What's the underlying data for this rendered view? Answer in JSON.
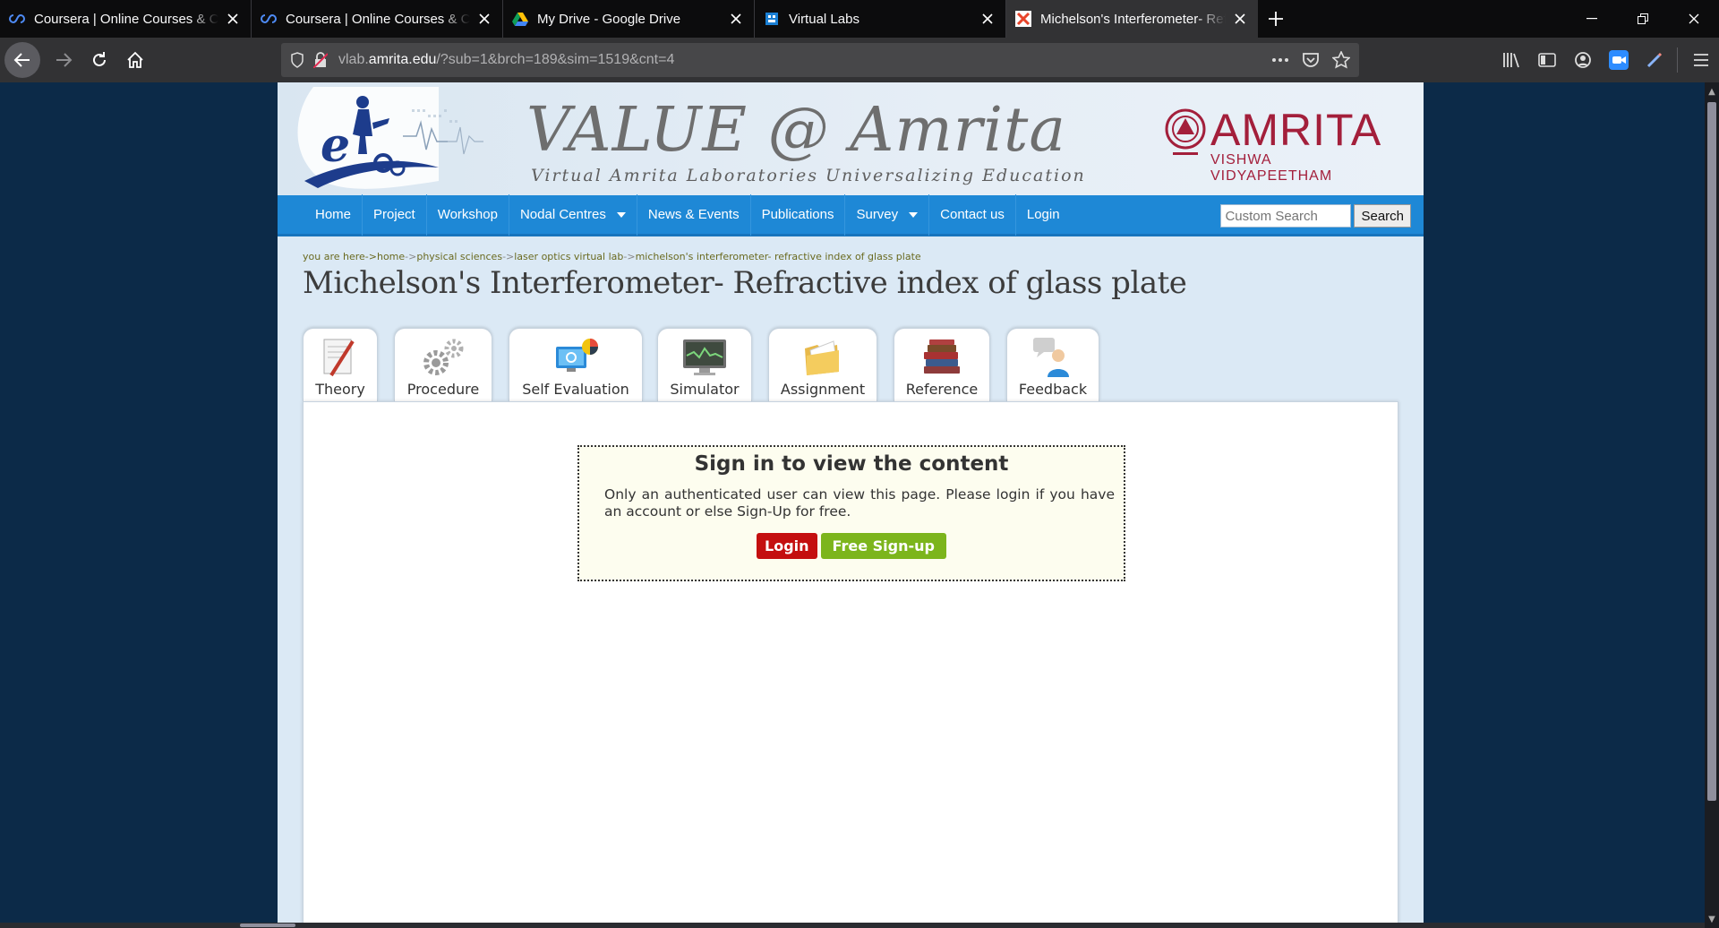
{
  "browser": {
    "tabs": [
      {
        "title": "Coursera | Online Courses & Credentials",
        "favicon": "coursera-icon",
        "active": false
      },
      {
        "title": "Coursera | Online Courses & Credentials",
        "favicon": "coursera-icon",
        "active": false
      },
      {
        "title": "My Drive - Google Drive",
        "favicon": "google-drive-icon",
        "active": false
      },
      {
        "title": "Virtual Labs",
        "favicon": "virtual-labs-icon",
        "active": false
      },
      {
        "title": "Michelson's Interferometer- Refractive index of glass plate",
        "favicon": "vlab-icon",
        "active": true
      }
    ],
    "url_prefix": "vlab.",
    "url_domain": "amrita.edu",
    "url_path": "/?sub=1&brch=189&sim=1519&cnt=4"
  },
  "site": {
    "title": "VALUE @ Amrita",
    "tagline": "Virtual Amrita Laboratories Universalizing Education",
    "logo_letter": "e",
    "org_name": "AMRITA",
    "org_sub": "VISHWA VIDYAPEETHAM"
  },
  "menu": {
    "items": [
      "Home",
      "Project",
      "Workshop",
      "Nodal Centres",
      "News & Events",
      "Publications",
      "Survey",
      "Contact us",
      "Login"
    ],
    "search_placeholder": "Custom Search",
    "search_button": "Search"
  },
  "breadcrumb": {
    "prefix": "you are here->",
    "items": [
      "home",
      "physical sciences",
      "laser optics virtual lab",
      "michelson's interferometer- refractive index of glass plate"
    ]
  },
  "page": {
    "title": "Michelson's Interferometer- Refractive index of glass plate",
    "tabs": [
      "Theory",
      "Procedure",
      "Self Evaluation",
      "Simulator",
      "Assignment",
      "Reference",
      "Feedback"
    ]
  },
  "signin": {
    "heading": "Sign in to view the content",
    "message": "Only an authenticated user can view this page. Please login if you have an account or else Sign-Up for free.",
    "login_label": "Login",
    "signup_label": "Free Sign-up"
  },
  "colors": {
    "menu_bg": "#1e88d6",
    "brand_red": "#a31f3b",
    "login_btn": "#c40f0f",
    "signup_btn": "#7cb51c"
  }
}
